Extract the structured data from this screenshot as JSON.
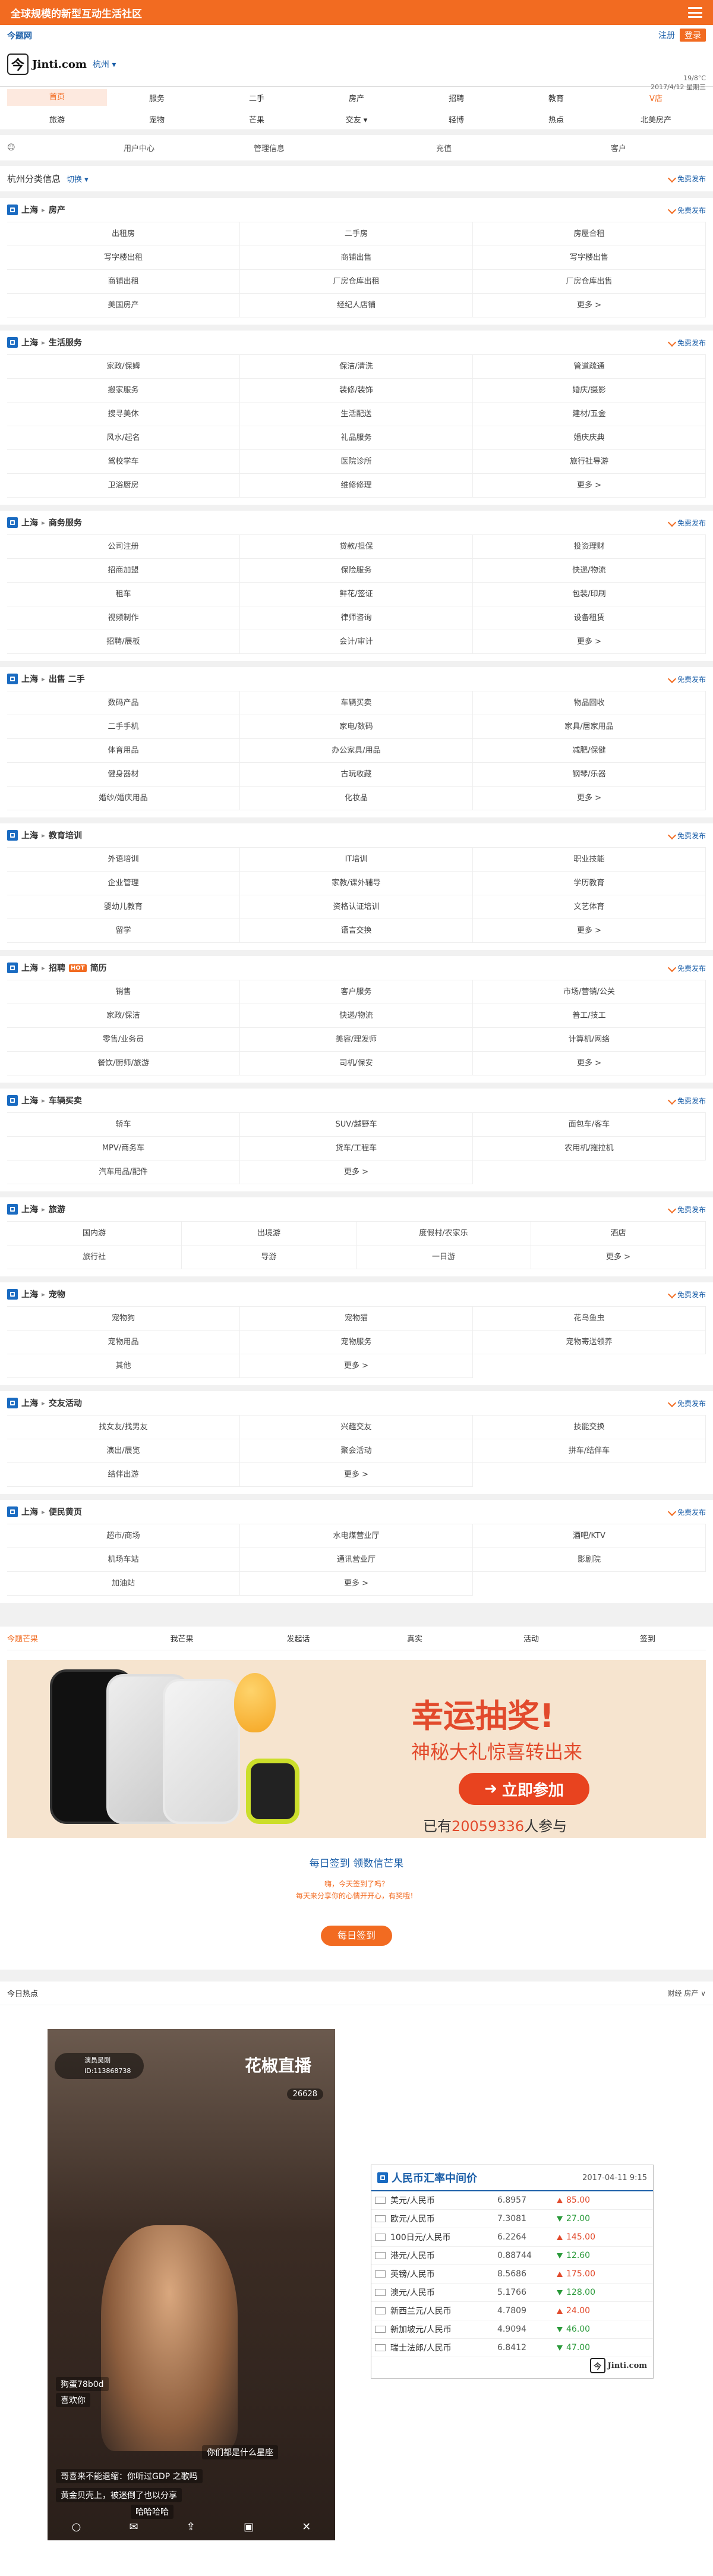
{
  "topbar": {
    "title": "全球规模的新型互动生活社区"
  },
  "header": {
    "site_name": "今题网",
    "register": "注册",
    "login": "登录",
    "logo_char": "今",
    "logo_text": "Jinti.com",
    "city": "杭州",
    "weather_temp": "19/8°C",
    "date": "2017/4/12 星期三"
  },
  "nav": {
    "row1": [
      "首页",
      "服务",
      "二手",
      "房产",
      "招聘",
      "教育",
      "V店"
    ],
    "row2": [
      "旅游",
      "宠物",
      "芒果",
      "交友",
      "轻博",
      "热点",
      "北美房产"
    ]
  },
  "userbar": {
    "items": [
      "用户中心",
      "管理信息",
      "充值",
      "客户"
    ]
  },
  "classbar": {
    "title": "杭州分类信息",
    "switch": "切换",
    "free_post": "免费发布"
  },
  "sections": [
    {
      "title": "上海",
      "name": "房产",
      "items": [
        "出租房",
        "二手房",
        "房屋合租",
        "写字楼出租",
        "商铺出售",
        "写字楼出售",
        "商铺出租",
        "厂房仓库出租",
        "厂房仓库出售",
        "美国房产",
        "经纪人店铺",
        "更多 >"
      ]
    },
    {
      "title": "上海",
      "name": "生活服务",
      "items": [
        "家政/保姆",
        "保洁/清洗",
        "管道疏通",
        "搬家服务",
        "装修/装饰",
        "婚庆/摄影",
        "搜寻美休",
        "生活配送",
        "建材/五金",
        "风水/起名",
        "礼品服务",
        "婚庆庆典",
        "驾校学车",
        "医院诊所",
        "旅行社导游",
        "卫浴厨房",
        "维修修理",
        "更多 >"
      ]
    },
    {
      "title": "上海",
      "name": "商务服务",
      "items": [
        "公司注册",
        "贷款/担保",
        "投资理财",
        "招商加盟",
        "保险服务",
        "快递/物流",
        "租车",
        "鲜花/签证",
        "包装/印刷",
        "视频制作",
        "律师咨询",
        "设备租赁",
        "招聘/展板",
        "会计/审计",
        "更多 >"
      ]
    },
    {
      "title": "上海",
      "name": "出售 二手",
      "items": [
        "数码产品",
        "车辆买卖",
        "物品回收",
        "二手手机",
        "家电/数码",
        "家具/居家用品",
        "体育用品",
        "办公家具/用品",
        "减肥/保健",
        "健身器材",
        "古玩收藏",
        "钢琴/乐器",
        "婚纱/婚庆用品",
        "化妆品",
        "更多 >"
      ]
    },
    {
      "title": "上海",
      "name": "教育培训",
      "items": [
        "外语培训",
        "IT培训",
        "职业技能",
        "企业管理",
        "家教/课外辅导",
        "学历教育",
        "婴幼儿教育",
        "资格认证培训",
        "文艺体育",
        "留学",
        "语言交换",
        "更多 >"
      ]
    },
    {
      "title": "上海",
      "name": "招聘",
      "badge": "HOT",
      "extra": "简历",
      "items": [
        "销售",
        "客户服务",
        "市场/营销/公关",
        "家政/保洁",
        "快递/物流",
        "普工/技工",
        "零售/业务员",
        "美容/理发师",
        "计算机/网络",
        "餐饮/厨师/旅游",
        "司机/保安",
        "更多 >"
      ]
    },
    {
      "title": "上海",
      "name": "车辆买卖",
      "items": [
        "轿车",
        "SUV/越野车",
        "面包车/客车",
        "MPV/商务车",
        "货车/工程车",
        "农用机/拖拉机",
        "汽车用品/配件",
        "更多 >"
      ]
    },
    {
      "title": "上海",
      "name": "旅游",
      "items": [
        "国内游",
        "出境游",
        "度假村/农家乐",
        "酒店",
        "旅行社",
        "导游",
        "一日游",
        "更多 >"
      ]
    },
    {
      "title": "上海",
      "name": "宠物",
      "items": [
        "宠物狗",
        "宠物猫",
        "花鸟鱼虫",
        "宠物用品",
        "宠物服务",
        "宠物寄送领养",
        "其他",
        "更多 >"
      ]
    },
    {
      "title": "上海",
      "name": "交友活动",
      "items": [
        "找女友/找男友",
        "兴趣交友",
        "技能交换",
        "演出/展览",
        "聚会活动",
        "拼车/结伴车",
        "结伴出游",
        "更多 >"
      ]
    },
    {
      "title": "上海",
      "name": "便民黄页",
      "items": [
        "超市/商场",
        "水电煤营业厅",
        "酒吧/KTV",
        "机场车站",
        "通讯营业厅",
        "影剧院",
        "加油站",
        "更多 >"
      ]
    }
  ],
  "mango": {
    "title": "今题芒果",
    "tabs": [
      "我芒果",
      "发起话",
      "真实",
      "活动",
      "签到"
    ],
    "banner_title": "幸运抽奖!",
    "banner_sub": "神秘大礼惊喜转出来",
    "banner_btn": "立即参加",
    "join_prefix": "已有",
    "join_count": "20059336",
    "join_suffix": "人参与",
    "sign_text": "每日签到 领数信芒果",
    "sign_sub1": "嗨，今天签到了吗？",
    "sign_sub2": "每天来分享你的心情开开心，有奖哦！",
    "sign_btn": "每日签到"
  },
  "hot": {
    "title": "今日热点",
    "right": "财经  房产  ∨"
  },
  "live": {
    "title": "花椒直播",
    "user": "演员吴刚",
    "userid": "ID:113868738",
    "count": "26628",
    "comments": [
      "狗蛋78b0d",
      "喜欢你",
      "你们都是什么星座",
      "哥喜来不能退缩：你听过GDP 之歌吗",
      "黄金贝壳上，被迷倒了也以分享",
      "哈哈哈哈"
    ]
  },
  "rates": {
    "title": "人民币汇率中间价",
    "date": "2017-04-11 9:15",
    "rows": [
      {
        "name": "美元/人民币",
        "value": "6.8957",
        "delta": "85.00",
        "dir": "up"
      },
      {
        "name": "欧元/人民币",
        "value": "7.3081",
        "delta": "27.00",
        "dir": "down"
      },
      {
        "name": "100日元/人民币",
        "value": "6.2264",
        "delta": "145.00",
        "dir": "up"
      },
      {
        "name": "港元/人民币",
        "value": "0.88744",
        "delta": "12.60",
        "dir": "down"
      },
      {
        "name": "英镑/人民币",
        "value": "8.5686",
        "delta": "175.00",
        "dir": "up"
      },
      {
        "name": "澳元/人民币",
        "value": "5.1766",
        "delta": "128.00",
        "dir": "down"
      },
      {
        "name": "新西兰元/人民币",
        "value": "4.7809",
        "delta": "24.00",
        "dir": "up"
      },
      {
        "name": "新加坡元/人民币",
        "value": "4.9094",
        "delta": "46.00",
        "dir": "down"
      },
      {
        "name": "瑞士法郎/人民币",
        "value": "6.8412",
        "delta": "47.00",
        "dir": "down"
      }
    ],
    "logo": "Jinti.com"
  }
}
